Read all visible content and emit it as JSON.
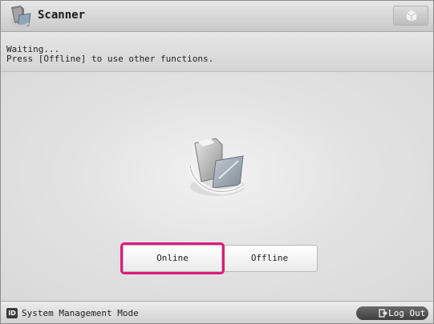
{
  "header": {
    "title": "Scanner",
    "app_icon": "scanner-icon",
    "corner_icon": "cube-icon"
  },
  "message": {
    "line1": "Waiting...",
    "line2": "Press [Offline] to use other functions."
  },
  "main": {
    "illustration": "scanner-waiting-icon",
    "buttons": {
      "online_label": "Online",
      "offline_label": "Offline",
      "selected": "Online"
    }
  },
  "footer": {
    "mode_badge": "ID",
    "mode_label": "System Management Mode",
    "logout_label": "Log Out",
    "logout_icon": "logout-icon"
  },
  "colors": {
    "focus": "#e0197c",
    "background": "#dcdcdc"
  }
}
